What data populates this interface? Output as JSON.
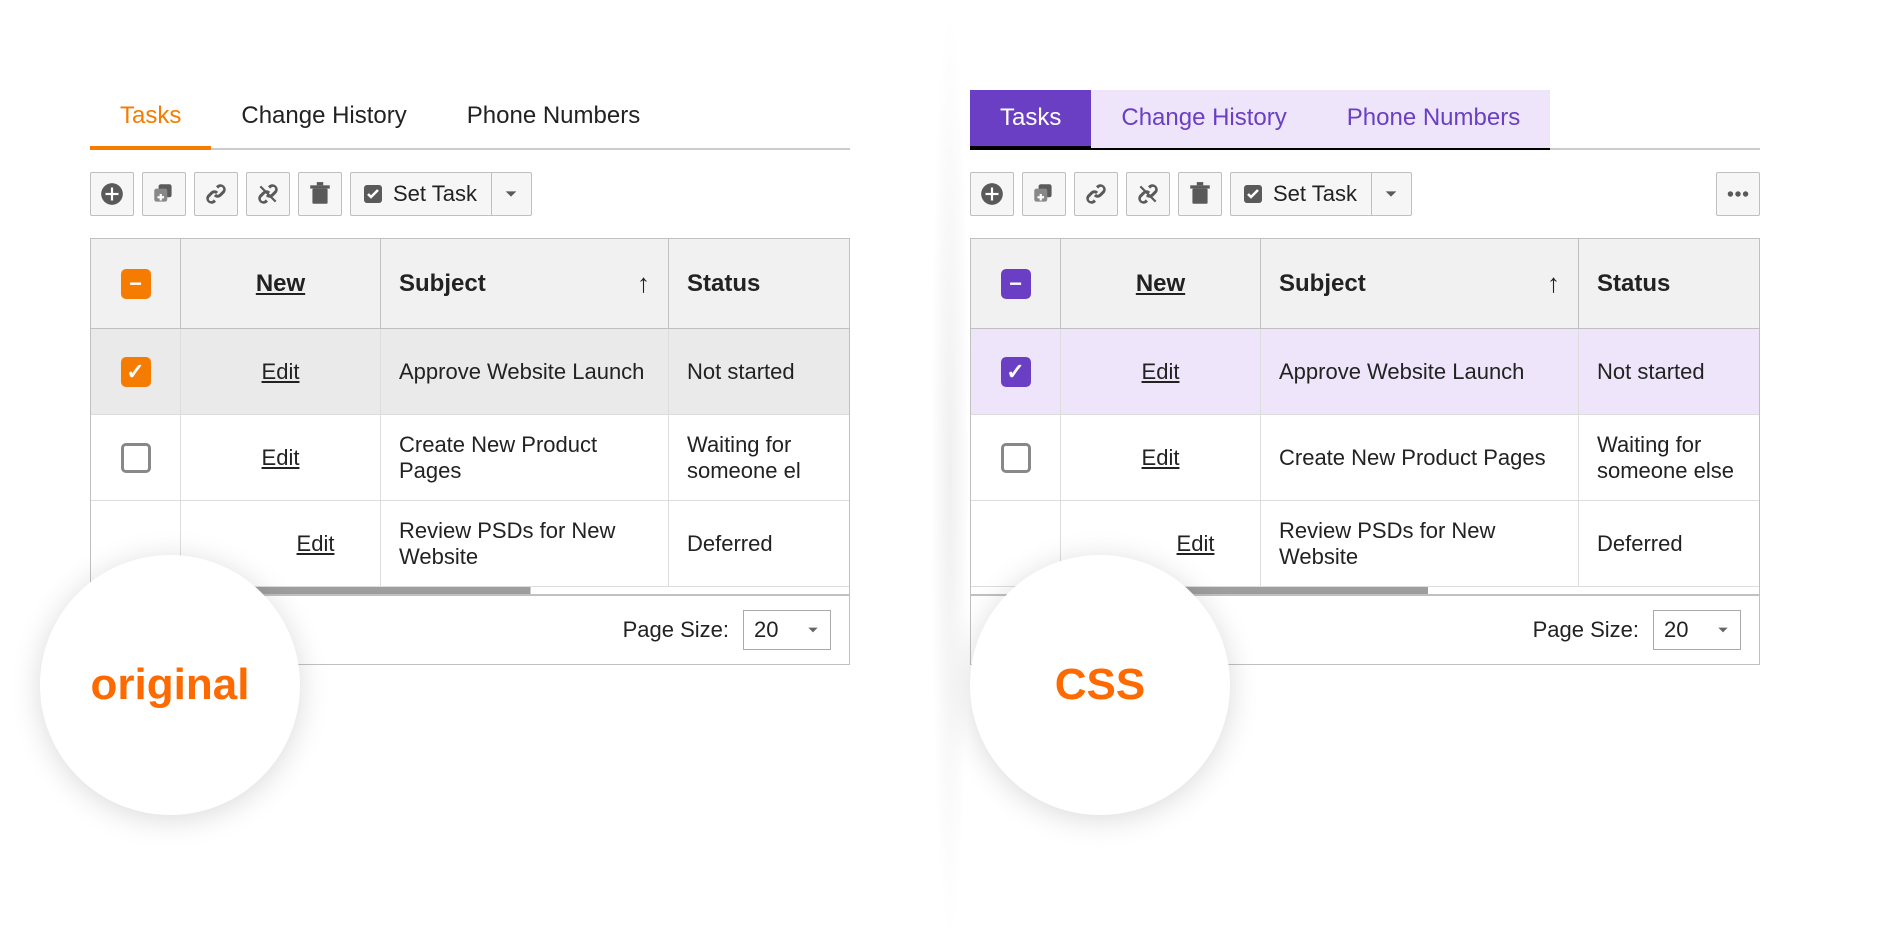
{
  "tabs": {
    "items": [
      {
        "label": "Tasks"
      },
      {
        "label": "Change History"
      },
      {
        "label": "Phone Numbers"
      }
    ]
  },
  "toolbar": {
    "set_task_label": "Set Task"
  },
  "grid": {
    "headers": {
      "action": "New",
      "subject": "Subject",
      "status": "Status"
    },
    "rows": [
      {
        "action": "Edit",
        "subject": "Approve Website Launch",
        "status_short": "Not started",
        "status_full": "Not started"
      },
      {
        "action": "Edit",
        "subject": "Create New Product Pages",
        "status_short": "Waiting for someone el",
        "status_full": "Waiting for someone else"
      },
      {
        "action": "Edit",
        "subject": "Review PSDs for New Website",
        "status_short": "Deferred",
        "status_full": "Deferred"
      }
    ]
  },
  "pager": {
    "label": "Page Size:",
    "value": "20"
  },
  "badges": {
    "left": "original",
    "right": "CSS"
  },
  "colors": {
    "accent_original": "#f57c00",
    "accent_css": "#6b3fc4"
  }
}
